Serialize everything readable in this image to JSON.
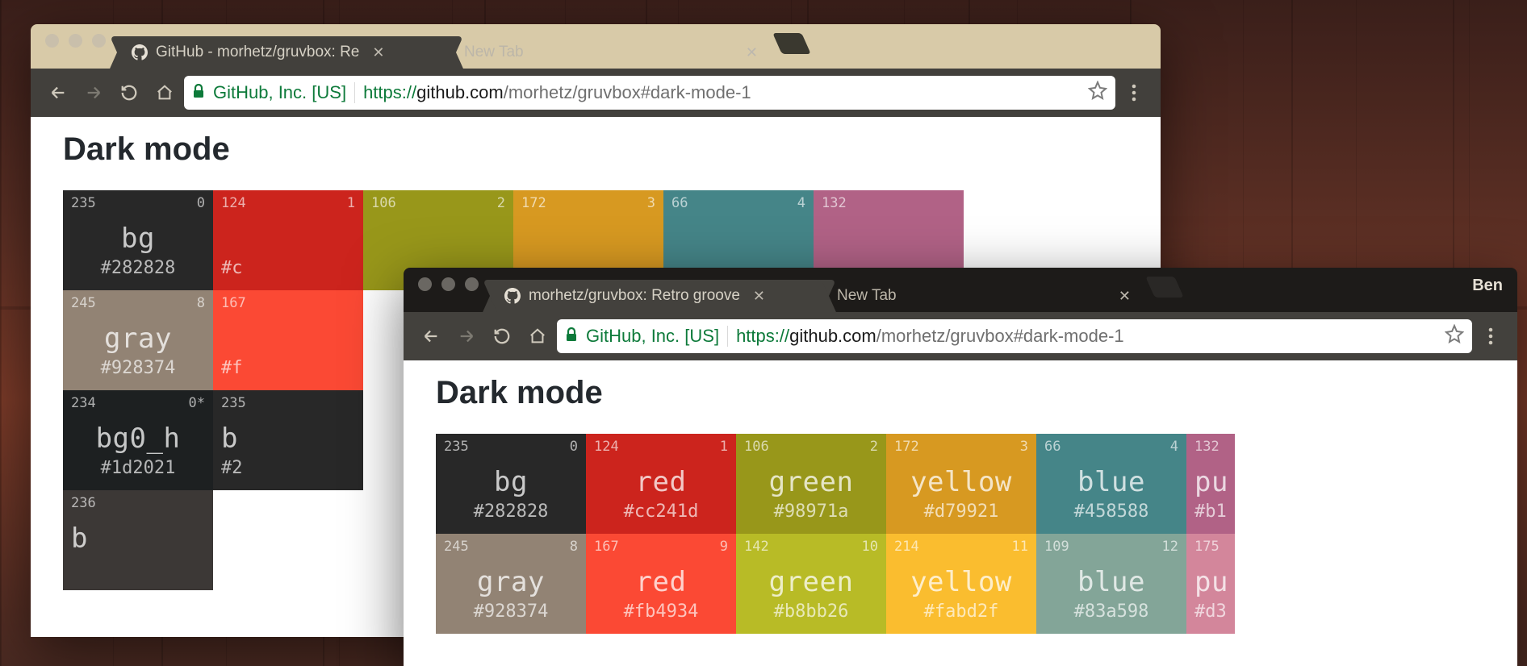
{
  "browser1": {
    "tabs": [
      {
        "title": "GitHub - morhetz/gruvbox: Re",
        "favicon": "github"
      },
      {
        "title": "New Tab",
        "favicon": "none"
      }
    ],
    "ev_cert": "GitHub, Inc. [US]",
    "url_scheme": "https://",
    "url_host": "github.com",
    "url_path": "/morhetz/gruvbox#dark-mode-1",
    "heading": "Dark mode",
    "right_icon": "incognito"
  },
  "browser2": {
    "tabs": [
      {
        "title": "morhetz/gruvbox: Retro groove",
        "favicon": "github"
      },
      {
        "title": "New Tab",
        "favicon": "none"
      }
    ],
    "ev_cert": "GitHub, Inc. [US]",
    "url_scheme": "https://",
    "url_host": "github.com",
    "url_path": "/morhetz/gruvbox#dark-mode-1",
    "heading": "Dark mode",
    "profile": "Ben"
  },
  "palette1": {
    "rows": [
      [
        {
          "l": "235",
          "r": "0",
          "name": "bg",
          "hex": "#282828",
          "bg": "#282828"
        },
        {
          "l": "124",
          "r": "1",
          "name": "",
          "hex": "#c",
          "bg": "#cc241d"
        },
        {
          "l": "106",
          "r": "2",
          "name": "",
          "hex": "",
          "bg": "#98971a"
        },
        {
          "l": "172",
          "r": "3",
          "name": "",
          "hex": "",
          "bg": "#d79921"
        },
        {
          "l": "66",
          "r": "4",
          "name": "",
          "hex": "",
          "bg": "#458588"
        },
        {
          "l": "132",
          "r": "",
          "name": "",
          "hex": "",
          "bg": "#b16286"
        }
      ],
      [
        {
          "l": "245",
          "r": "8",
          "name": "gray",
          "hex": "#928374",
          "bg": "#928374"
        },
        {
          "l": "167",
          "r": "",
          "name": "",
          "hex": "#f",
          "bg": "#fb4934"
        }
      ],
      [
        {
          "l": "234",
          "r": "0*",
          "name": "bg0_h",
          "hex": "#1d2021",
          "bg": "#1d2021"
        },
        {
          "l": "235",
          "r": "",
          "name": "b",
          "hex": "#2",
          "bg": "#282828"
        }
      ],
      [
        {
          "l": "236",
          "r": "",
          "name": "b",
          "hex": "",
          "bg": "#3c3836"
        }
      ]
    ]
  },
  "palette2": {
    "rows": [
      [
        {
          "l": "235",
          "r": "0",
          "name": "bg",
          "hex": "#282828",
          "bg": "#282828"
        },
        {
          "l": "124",
          "r": "1",
          "name": "red",
          "hex": "#cc241d",
          "bg": "#cc241d"
        },
        {
          "l": "106",
          "r": "2",
          "name": "green",
          "hex": "#98971a",
          "bg": "#98971a"
        },
        {
          "l": "172",
          "r": "3",
          "name": "yellow",
          "hex": "#d79921",
          "bg": "#d79921"
        },
        {
          "l": "66",
          "r": "4",
          "name": "blue",
          "hex": "#458588",
          "bg": "#458588"
        },
        {
          "l": "132",
          "r": "",
          "name": "pu",
          "hex": "#b1",
          "bg": "#b16286"
        }
      ],
      [
        {
          "l": "245",
          "r": "8",
          "name": "gray",
          "hex": "#928374",
          "bg": "#928374"
        },
        {
          "l": "167",
          "r": "9",
          "name": "red",
          "hex": "#fb4934",
          "bg": "#fb4934"
        },
        {
          "l": "142",
          "r": "10",
          "name": "green",
          "hex": "#b8bb26",
          "bg": "#b8bb26"
        },
        {
          "l": "214",
          "r": "11",
          "name": "yellow",
          "hex": "#fabd2f",
          "bg": "#fabd2f"
        },
        {
          "l": "109",
          "r": "12",
          "name": "blue",
          "hex": "#83a598",
          "bg": "#83a598"
        },
        {
          "l": "175",
          "r": "",
          "name": "pu",
          "hex": "#d3",
          "bg": "#d3869b"
        }
      ]
    ]
  }
}
